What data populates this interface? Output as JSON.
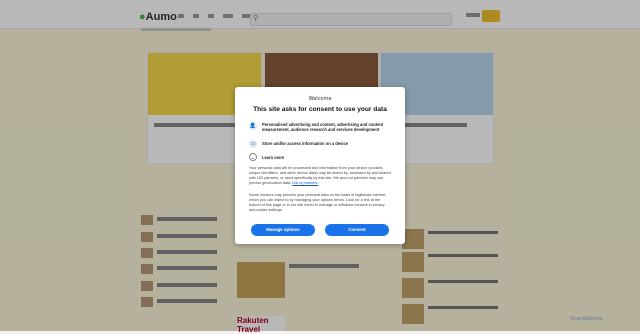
{
  "site": {
    "logo_text": "Aumo"
  },
  "watermark": "SnapWebsite",
  "background_banner": {
    "title": "Rakuten Travel"
  },
  "consent": {
    "welcome": "Welcome",
    "title": "This site asks for consent to use your data",
    "purposes": [
      {
        "icon": "person-icon",
        "label": "Personalised advertising and content, advertising and content measurement, audience research and services development"
      },
      {
        "icon": "device-icon",
        "label": "Store and/or access information on a device"
      }
    ],
    "learn_more": "Learn more",
    "body_1": "Your personal data will be processed and information from your device (cookies, unique identifiers, and other device data) may be stored by, accessed by and shared with 153 partners, or used specifically by this site. We and our partners may use precise geolocation data.",
    "body_1_link": "List of partners.",
    "body_2": "Some vendors may process your personal data on the basis of legitimate interest, which you can object to by managing your options below. Look for a link at the bottom of this page or in our site menu to manage or withdraw consent in privacy and cookie settings.",
    "manage_button": "Manage options",
    "consent_button": "Consent"
  },
  "colors": {
    "accent": "#1a73e8",
    "brand_green": "#3fb54c",
    "brand_yellow": "#f2c12e"
  }
}
